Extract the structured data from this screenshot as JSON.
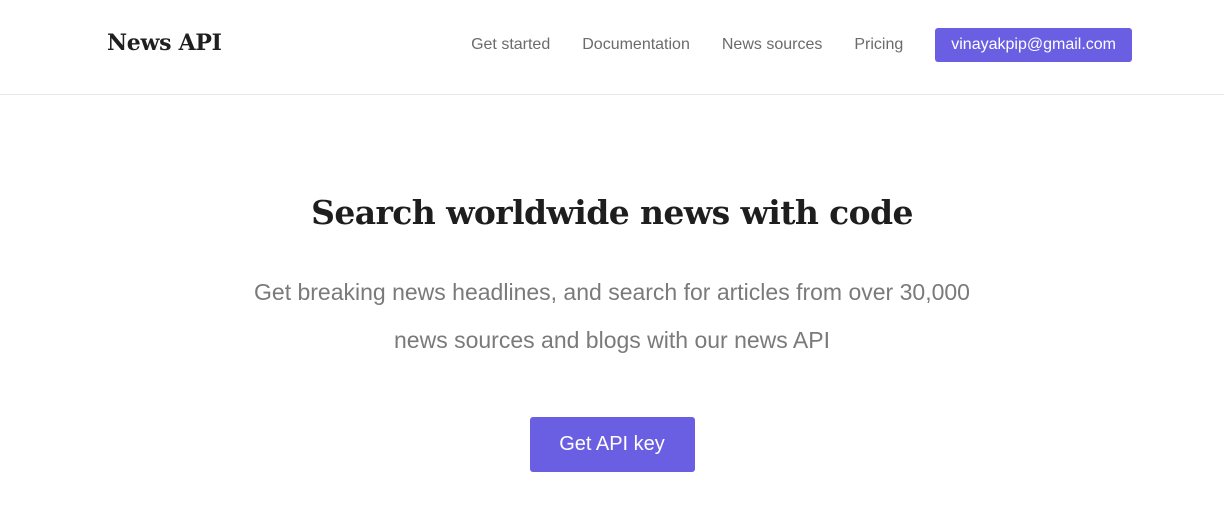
{
  "header": {
    "brand": "News API",
    "nav": [
      {
        "label": "Get started"
      },
      {
        "label": "Documentation"
      },
      {
        "label": "News sources"
      },
      {
        "label": "Pricing"
      }
    ],
    "account_label": "vinayakpip@gmail.com"
  },
  "hero": {
    "title": "Search worldwide news with code",
    "subtitle": "Get breaking news headlines, and search for articles from over 30,000 news sources and blogs with our news API",
    "cta_label": "Get API key"
  },
  "colors": {
    "accent": "#6a5fe3",
    "title_text": "#1e1e1e",
    "muted_text": "#7a7a7a",
    "nav_text": "#6b6b6b"
  }
}
